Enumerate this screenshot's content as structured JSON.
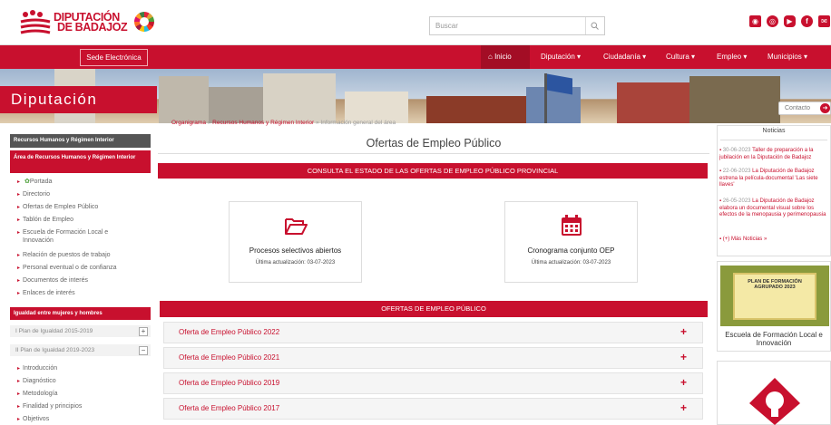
{
  "header": {
    "logo_line1": "DIPUTACIÓN",
    "logo_line2": "DE BADAJOZ",
    "search_placeholder": "Buscar"
  },
  "nav": {
    "sede": "Sede Electrónica",
    "items": [
      "Inicio",
      "Diputación ▾",
      "Ciudadanía ▾",
      "Cultura ▾",
      "Empleo ▾",
      "Municipios ▾"
    ]
  },
  "banner": {
    "title": "Diputación",
    "contacto": "Contacto"
  },
  "sidebar": {
    "section1": "Recursos Humanos y Régimen Interior",
    "area": "Área de Recursos Humanos y Régimen Interior",
    "links": [
      "Portada",
      "Directorio",
      "Ofertas de Empleo Público",
      "Tablón de Empleo",
      "Escuela de Formación Local e",
      "Innovación",
      "Relación de puestos de trabajo",
      "Personal eventual o de confianza",
      "Documentos de interés",
      "Enlaces de interés"
    ],
    "igualdad": "Igualdad entre mujeres y hombres",
    "plans": [
      "I Plan de Igualdad 2015-2019",
      "II Plan de Igualdad 2019-2023"
    ],
    "sub_links": [
      "Introducción",
      "Diagnóstico",
      "Metodología",
      "Finalidad y principios",
      "Objetivos"
    ]
  },
  "main": {
    "breadcrumb_1": "Organigrama",
    "breadcrumb_sep": " » ",
    "breadcrumb_2": "Recursos Humanos y Régimen Interior",
    "breadcrumb_3": "Información general del área",
    "title": "Ofertas de Empleo Público",
    "bar1": "CONSULTA EL ESTADO DE LAS OFERTAS DE EMPLEO PÚBLICO PROVINCIAL",
    "card1_title": "Procesos selectivos abiertos",
    "card1_sub": "Última actualización: 03-07-2023",
    "card2_title": "Cronograma conjunto OEP",
    "card2_sub": "Última actualización: 03-07-2023",
    "bar2": "OFERTAS DE EMPLEO PÚBLICO",
    "accordion": [
      "Oferta de Empleo Público 2022",
      "Oferta de Empleo Público 2021",
      "Oferta de Empleo Público 2019",
      "Oferta de Empleo Público 2017"
    ]
  },
  "news": {
    "title": "Noticias",
    "items": [
      {
        "date": "30-06-2023",
        "text": "Taller de preparación a la jubilación en la Diputación de Badajoz"
      },
      {
        "date": "22-06-2023",
        "text": "La Diputación de Badajoz estrena la película-documental 'Las siete llaves'"
      },
      {
        "date": "26-05-2023",
        "text": "La Diputación de Badajoz elabora un documental visual sobre los efectos de la menopausia y perimenopausia"
      }
    ],
    "more": "(+) Más Noticias »"
  },
  "promo": {
    "img_title": "PLAN DE FORMACIÓN AGRUPADO 2023",
    "caption": "Escuela de Formación Local e Innovación"
  },
  "colors": {
    "brand": "#c8102e",
    "dark": "#555555"
  }
}
